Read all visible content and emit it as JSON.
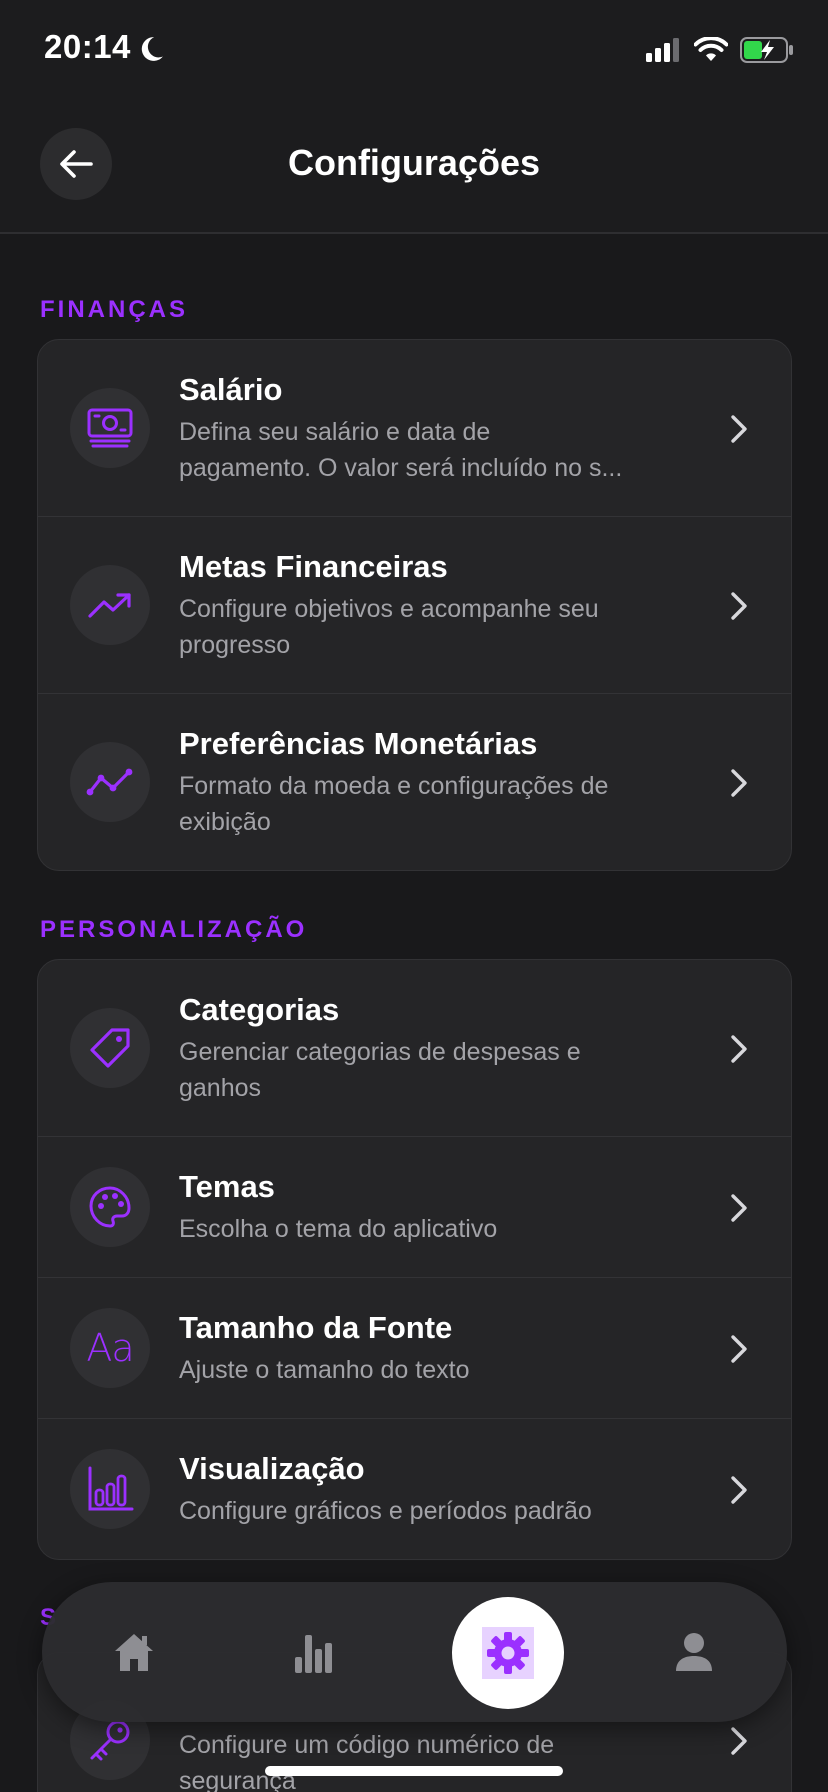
{
  "status_bar": {
    "time": "20:14"
  },
  "header": {
    "title": "Configurações"
  },
  "sections": [
    {
      "title": "FINANÇAS",
      "items": [
        {
          "title": "Salário",
          "desc_lines": [
            "Defina seu salário e data de",
            "pagamento. O valor será incluído no s..."
          ],
          "icon": "money-icon"
        },
        {
          "title": "Metas Financeiras",
          "desc_lines": [
            "Configure objetivos e acompanhe seu",
            "progresso"
          ],
          "icon": "trending-up-icon"
        },
        {
          "title": "Preferências Monetárias",
          "desc_lines": [
            "Formato da moeda e configurações de",
            "exibição"
          ],
          "icon": "line-chart-icon"
        }
      ]
    },
    {
      "title": "PERSONALIZAÇÃO",
      "items": [
        {
          "title": "Categorias",
          "desc_lines": [
            "Gerenciar categorias de despesas e",
            "ganhos"
          ],
          "icon": "tag-icon"
        },
        {
          "title": "Temas",
          "desc_lines": [
            "Escolha o tema do aplicativo"
          ],
          "icon": "palette-icon"
        },
        {
          "title": "Tamanho da Fonte",
          "desc_lines": [
            "Ajuste o tamanho do texto"
          ],
          "icon": "font-size-icon",
          "icon_text": "Aa"
        },
        {
          "title": "Visualização",
          "desc_lines": [
            "Configure gráficos e períodos padrão"
          ],
          "icon": "bar-chart-icon"
        }
      ]
    },
    {
      "title_partial": "S",
      "items": [
        {
          "title": "",
          "desc_lines": [
            "Configure um código numérico de",
            "segurança"
          ],
          "icon": "key-icon"
        }
      ]
    }
  ],
  "tab_bar": {
    "tabs": [
      "home-icon",
      "stats-icon",
      "settings-icon",
      "user-icon"
    ],
    "active_tab": "settings-icon"
  },
  "colors": {
    "accent": "#9b30ff",
    "background": "#19191b",
    "card": "#252527",
    "text_secondary": "#a3a3a8"
  }
}
